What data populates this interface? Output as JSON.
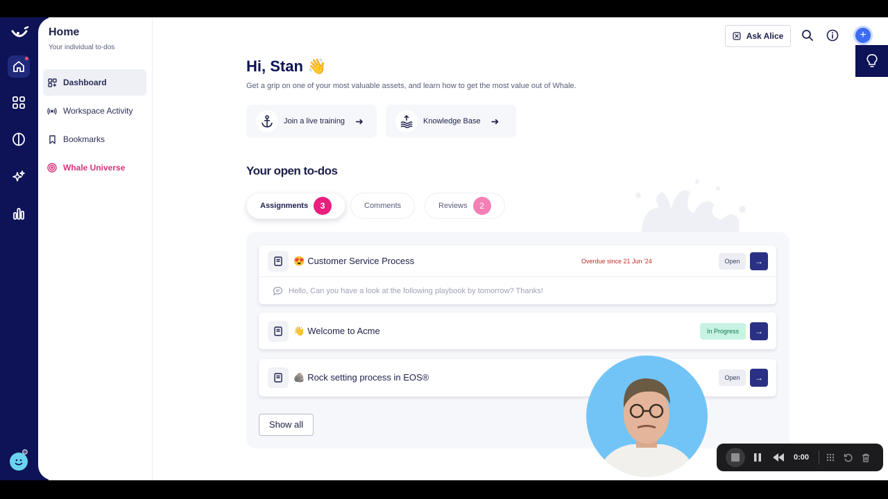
{
  "sidebar": {
    "title": "Home",
    "subtitle": "Your individual to-dos",
    "items": [
      {
        "label": "Dashboard",
        "icon": "dashboard-icon"
      },
      {
        "label": "Workspace Activity",
        "icon": "broadcast-icon"
      },
      {
        "label": "Bookmarks",
        "icon": "bookmark-icon"
      },
      {
        "label": "Whale Universe",
        "icon": "target-icon"
      }
    ]
  },
  "rail": {
    "icons": [
      "whale-logo-icon",
      "home-icon",
      "apps-grid-icon",
      "brain-icon",
      "sparkles-icon",
      "analytics-icon"
    ]
  },
  "header": {
    "ask_label": "Ask Alice",
    "plus_label": "+"
  },
  "greeting": {
    "title": "Hi, Stan",
    "emoji": "👋",
    "subtitle": "Get a grip on one of your most valuable assets, and learn how to get the most value out of Whale."
  },
  "quick_links": [
    {
      "label": "Join a live training",
      "icon": "anchor-icon"
    },
    {
      "label": "Knowledge Base",
      "icon": "waves-icon"
    }
  ],
  "todos_section": {
    "title": "Your open to-dos",
    "tabs": [
      {
        "label": "Assignments",
        "badge": "3"
      },
      {
        "label": "Comments"
      },
      {
        "label": "Reviews",
        "badge": "2"
      }
    ]
  },
  "todos": [
    {
      "emoji": "😍",
      "title": "Customer Service Process",
      "overdue": "Overdue since 21 Jun '24",
      "status": "Open",
      "comment": "Hello, Can you have a look at the following playbook by tomorrow? Thanks!"
    },
    {
      "emoji": "👋",
      "title": "Welcome to Acme",
      "status": "In Progress"
    },
    {
      "emoji": "🪨",
      "title": "Rock setting process in EOS®",
      "status": "Open"
    }
  ],
  "show_all_label": "Show all",
  "go_arrow": "→",
  "recorder": {
    "time": "0:00"
  },
  "colors": {
    "rail": "#0d1356",
    "accent_pink": "#e91e7f",
    "primary_button": "#2a3185"
  }
}
